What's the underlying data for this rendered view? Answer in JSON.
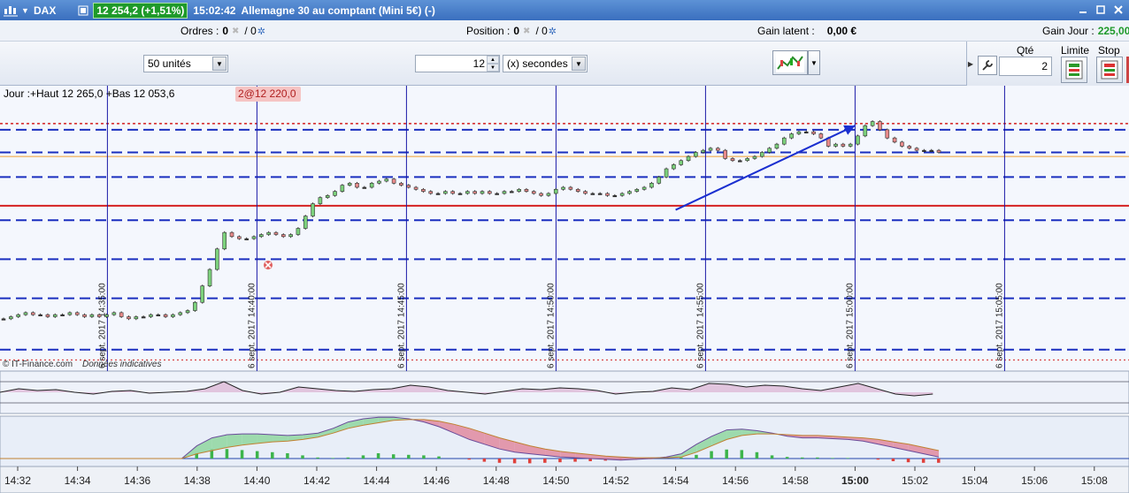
{
  "titlebar": {
    "symbol": "DAX",
    "price_change": "12 254,2 (+1,51%)",
    "time": "15:02:42",
    "instrument_name": "Allemagne 30 au comptant (Mini 5€) (-)"
  },
  "infobar": {
    "orders_label": "Ordres :",
    "orders_value": "0",
    "orders_slash": "/ 0",
    "position_label": "Position :",
    "position_value": "0",
    "position_slash": "/ 0",
    "gain_latent_label": "Gain latent :",
    "gain_latent_value": "0,00 €",
    "gain_jour_label": "Gain Jour :",
    "gain_jour_value": "225,00"
  },
  "controls": {
    "units_select": "50 unités",
    "period_value": "12",
    "period_unit_select": "(x) secondes"
  },
  "order_panel": {
    "qty_label": "Qté",
    "qty_value": "2",
    "limit_label": "Limite",
    "stop_label": "Stop"
  },
  "chart_overlay": {
    "day_range": "Jour :+Haut 12 265,0 +Bas 12 053,6",
    "position_marker": "2@12 220,0",
    "copyright": "© IT-Finance.com",
    "disclaimer": "Données indicatives"
  },
  "colors": {
    "title_bg": "#4a7fcc",
    "price_badge": "#1f9a2a",
    "bull_candle": "#7cd17c",
    "bear_candle": "#e88a8a",
    "support_dashed": "#1a2fbf",
    "red_level": "#d42020",
    "orange_level": "#f0a030",
    "vertical_lines": "#1a1aa8",
    "arrow": "#1a2fd0"
  },
  "chart_data": {
    "type": "candlestick",
    "title": "",
    "xlabel": "",
    "ylabel": "",
    "x_ticks": [
      "14:32",
      "14:34",
      "14:36",
      "14:38",
      "14:40",
      "14:42",
      "14:44",
      "14:46",
      "14:48",
      "14:50",
      "14:52",
      "14:54",
      "14:56",
      "14:58",
      "15:00",
      "15:02",
      "15:04",
      "15:06",
      "15:08"
    ],
    "x_ticks_bold": [
      "15:00"
    ],
    "vertical_separators": [
      "6 sept. 2017 14:35:00",
      "6 sept. 2017 14:40:00",
      "6 sept. 2017 14:45:00",
      "6 sept. 2017 14:50:00",
      "6 sept. 2017 14:55:00",
      "6 sept. 2017 15:00:00",
      "6 sept. 2017 15:05:00"
    ],
    "price_series": [
      12180,
      12181,
      12182,
      12183,
      12182,
      12182,
      12181,
      12182,
      12182,
      12183,
      12182,
      12181,
      12182,
      12181,
      12182,
      12183,
      12181,
      12180,
      12181,
      12181,
      12182,
      12182,
      12181,
      12182,
      12183,
      12184,
      12188,
      12196,
      12204,
      12214,
      12222,
      12220,
      12219,
      12219,
      12220,
      12221,
      12222,
      12221,
      12220,
      12221,
      12224,
      12230,
      12236,
      12239,
      12240,
      12242,
      12245,
      12246,
      12244,
      12244,
      12246,
      12247,
      12248,
      12246,
      12245,
      12244,
      12243,
      12242,
      12241,
      12241,
      12242,
      12241,
      12241,
      12242,
      12241,
      12242,
      12241,
      12241,
      12242,
      12242,
      12243,
      12242,
      12241,
      12240,
      12241,
      12243,
      12244,
      12243,
      12242,
      12241,
      12241,
      12241,
      12240,
      12240,
      12241,
      12242,
      12243,
      12244,
      12246,
      12249,
      12253,
      12255,
      12257,
      12259,
      12261,
      12262,
      12263,
      12262,
      12258,
      12257,
      12257,
      12258,
      12259,
      12261,
      12263,
      12265,
      12268,
      12270,
      12271,
      12271,
      12270,
      12268,
      12264,
      12265,
      12264,
      12265,
      12269,
      12274,
      12276,
      12272,
      12268,
      12266,
      12264,
      12263,
      12262,
      12262,
      12262,
      12261
    ],
    "price_levels": {
      "dotted_red_top": 12275,
      "blue_dashed": [
        12272,
        12261,
        12249,
        12228,
        12209,
        12190,
        12165
      ],
      "orange": 12259,
      "red_solid": 12235,
      "dotted_red_bottom": 12160
    },
    "position_entry": 12220.0,
    "day_high": 12265.0,
    "day_low": 12053.6,
    "indicator1": {
      "type": "line-with-fill",
      "values": [
        0,
        0.2,
        0.1,
        0.15,
        0.0,
        -0.1,
        0.05,
        0.1,
        -0.05,
        0.0,
        0.05,
        0.2,
        0.6,
        0.1,
        -0.1,
        0.0,
        0.3,
        0.2,
        0.1,
        0.05,
        0.15,
        0.2,
        0.4,
        0.3,
        0.1,
        0.0,
        -0.1,
        0.05,
        0.2,
        0.15,
        0.25,
        0.2,
        0.1,
        -0.1,
        0.0,
        0.05,
        0.25,
        0.15,
        0.5,
        0.45,
        0.3,
        0.4,
        0.35,
        0.2,
        0.1,
        0.3,
        0.5,
        0.2,
        -0.1,
        -0.2,
        -0.1
      ]
    },
    "indicator2": {
      "type": "macd",
      "histogram": [
        0,
        0,
        0,
        0,
        0,
        0,
        0,
        0,
        0,
        0,
        0,
        0,
        0,
        0.5,
        0.9,
        0.9,
        0.8,
        0.7,
        0.6,
        0.5,
        0.3,
        0.1,
        0.05,
        0.1,
        0.3,
        0.5,
        0.4,
        0.35,
        0.3,
        0.2,
        0,
        -0.1,
        -0.3,
        -0.4,
        -0.45,
        -0.45,
        -0.4,
        -0.35,
        -0.3,
        -0.25,
        -0.2,
        -0.15,
        -0.1,
        -0.05,
        0,
        0.1,
        0.35,
        0.7,
        0.85,
        0.8,
        0.6,
        0.3,
        0.15,
        0.1,
        0.1,
        0.05,
        0.05,
        0,
        -0.1,
        -0.25,
        -0.35,
        -0.4,
        -0.4
      ],
      "macd_line": [
        0,
        0,
        0,
        0,
        0,
        0,
        0,
        0,
        0,
        0,
        0,
        0,
        0,
        0.8,
        1.3,
        1.5,
        1.55,
        1.55,
        1.5,
        1.45,
        1.5,
        1.6,
        1.9,
        2.3,
        2.5,
        2.6,
        2.6,
        2.5,
        2.3,
        2.0,
        1.6,
        1.2,
        0.9,
        0.6,
        0.4,
        0.3,
        0.2,
        0.1,
        0.05,
        0.0,
        -0.05,
        -0.1,
        -0.05,
        0.0,
        0.1,
        0.3,
        0.9,
        1.4,
        1.8,
        1.85,
        1.75,
        1.6,
        1.4,
        1.3,
        1.3,
        1.25,
        1.2,
        1.1,
        0.9,
        0.7,
        0.5,
        0.3,
        0.1
      ],
      "signal_line": [
        0,
        0,
        0,
        0,
        0,
        0,
        0,
        0,
        0,
        0,
        0,
        0,
        0,
        0.3,
        0.5,
        0.7,
        0.85,
        0.95,
        1.05,
        1.1,
        1.2,
        1.35,
        1.6,
        1.9,
        2.1,
        2.25,
        2.4,
        2.45,
        2.45,
        2.35,
        2.15,
        1.9,
        1.6,
        1.3,
        1.05,
        0.8,
        0.6,
        0.45,
        0.35,
        0.25,
        0.15,
        0.1,
        0.05,
        0.05,
        0.05,
        0.1,
        0.4,
        0.8,
        1.2,
        1.45,
        1.55,
        1.55,
        1.5,
        1.45,
        1.45,
        1.4,
        1.35,
        1.3,
        1.2,
        1.05,
        0.9,
        0.7,
        0.5
      ]
    },
    "trend_arrow": {
      "from_price": 12233,
      "to_price": 12274
    }
  }
}
